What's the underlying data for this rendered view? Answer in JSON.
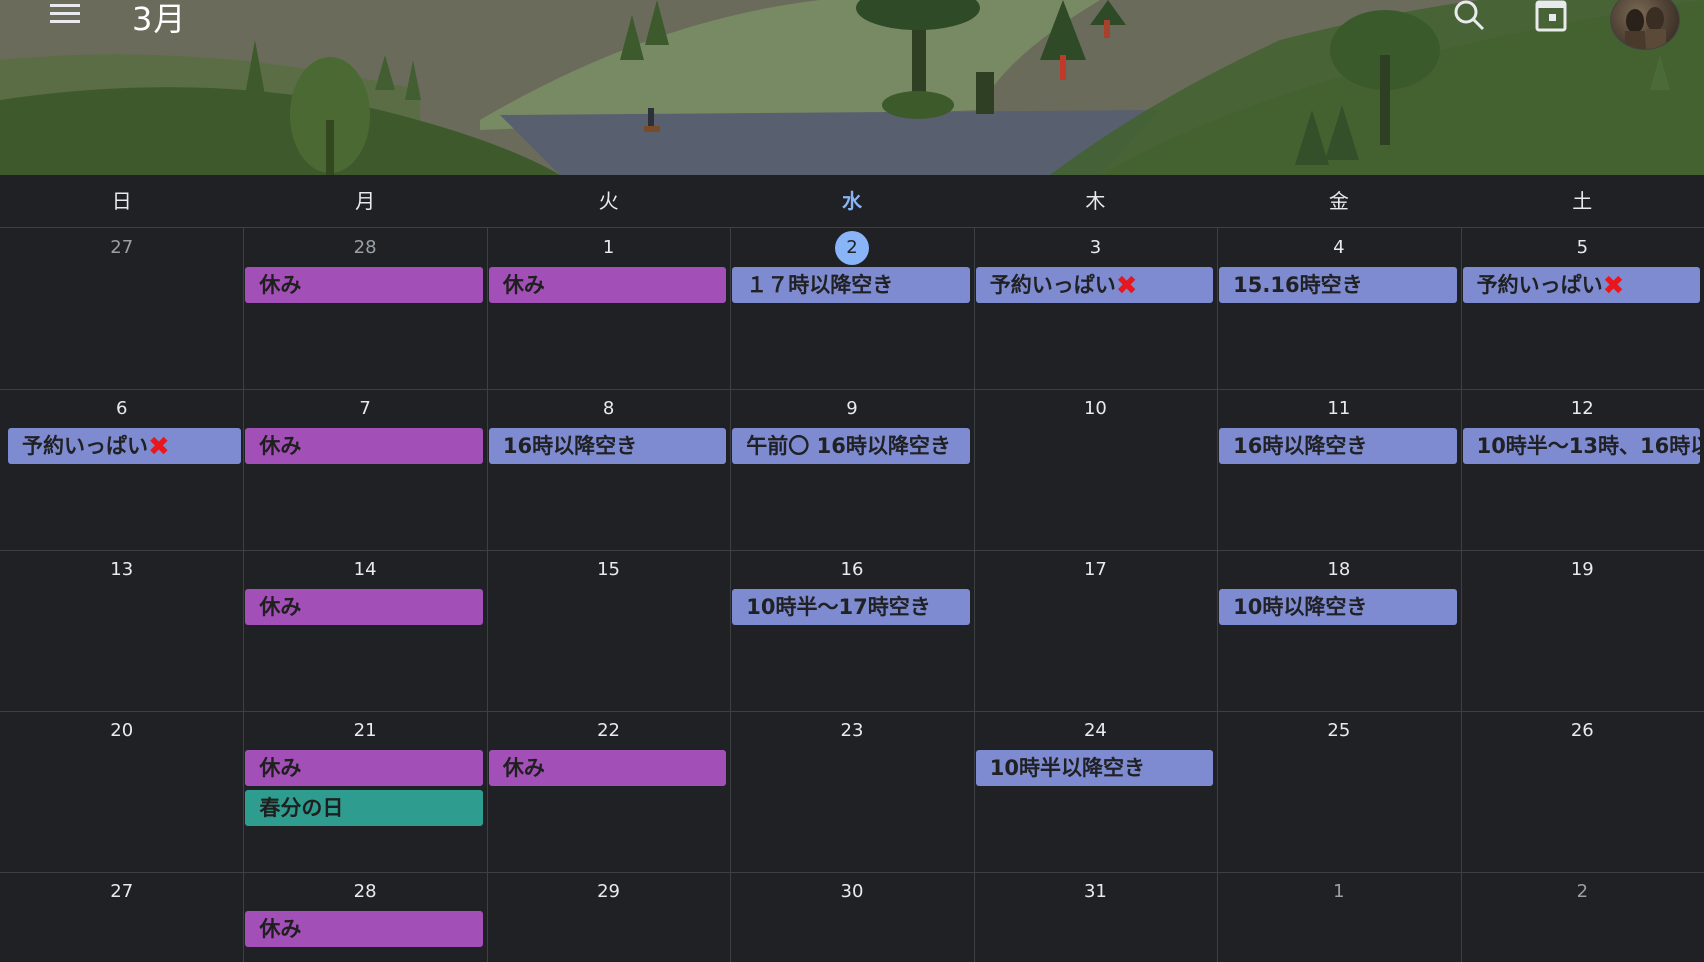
{
  "header": {
    "month_title": "3月",
    "icons": [
      "menu-icon",
      "search-icon",
      "calendar-today-icon",
      "avatar"
    ]
  },
  "weekdays": [
    {
      "label": "日",
      "today": false
    },
    {
      "label": "月",
      "today": false
    },
    {
      "label": "火",
      "today": false
    },
    {
      "label": "水",
      "today": true
    },
    {
      "label": "木",
      "today": false
    },
    {
      "label": "金",
      "today": false
    },
    {
      "label": "土",
      "today": false
    }
  ],
  "weeks": [
    [
      {
        "day": "27",
        "muted": true,
        "today": false,
        "events": []
      },
      {
        "day": "28",
        "muted": true,
        "today": false,
        "events": [
          {
            "label": "休み",
            "color": "purple",
            "mark": false
          }
        ]
      },
      {
        "day": "1",
        "muted": false,
        "today": false,
        "events": [
          {
            "label": "休み",
            "color": "purple",
            "mark": false
          }
        ]
      },
      {
        "day": "2",
        "muted": false,
        "today": true,
        "events": [
          {
            "label": "１７時以降空き",
            "color": "blue",
            "mark": false
          }
        ]
      },
      {
        "day": "3",
        "muted": false,
        "today": false,
        "events": [
          {
            "label": "予約いっぱい",
            "color": "blue",
            "mark": true
          }
        ]
      },
      {
        "day": "4",
        "muted": false,
        "today": false,
        "events": [
          {
            "label": "15.16時空き",
            "color": "blue",
            "mark": false
          }
        ]
      },
      {
        "day": "5",
        "muted": false,
        "today": false,
        "events": [
          {
            "label": "予約いっぱい",
            "color": "blue",
            "mark": true
          }
        ]
      }
    ],
    [
      {
        "day": "6",
        "muted": false,
        "today": false,
        "events": [
          {
            "label": "予約いっぱい",
            "color": "blue",
            "mark": true
          }
        ]
      },
      {
        "day": "7",
        "muted": false,
        "today": false,
        "events": [
          {
            "label": "休み",
            "color": "purple",
            "mark": false
          }
        ]
      },
      {
        "day": "8",
        "muted": false,
        "today": false,
        "events": [
          {
            "label": "16時以降空き",
            "color": "blue",
            "mark": false
          }
        ]
      },
      {
        "day": "9",
        "muted": false,
        "today": false,
        "events": [
          {
            "label": "午前〇 16時以降空き",
            "color": "blue",
            "mark": false
          }
        ]
      },
      {
        "day": "10",
        "muted": false,
        "today": false,
        "events": []
      },
      {
        "day": "11",
        "muted": false,
        "today": false,
        "events": [
          {
            "label": "16時以降空き",
            "color": "blue",
            "mark": false
          }
        ]
      },
      {
        "day": "12",
        "muted": false,
        "today": false,
        "events": [
          {
            "label": "10時半〜13時、16時以",
            "color": "blue",
            "mark": false
          }
        ]
      }
    ],
    [
      {
        "day": "13",
        "muted": false,
        "today": false,
        "events": []
      },
      {
        "day": "14",
        "muted": false,
        "today": false,
        "events": [
          {
            "label": "休み",
            "color": "purple",
            "mark": false
          }
        ]
      },
      {
        "day": "15",
        "muted": false,
        "today": false,
        "events": []
      },
      {
        "day": "16",
        "muted": false,
        "today": false,
        "events": [
          {
            "label": "10時半〜17時空き",
            "color": "blue",
            "mark": false
          }
        ]
      },
      {
        "day": "17",
        "muted": false,
        "today": false,
        "events": []
      },
      {
        "day": "18",
        "muted": false,
        "today": false,
        "events": [
          {
            "label": "10時以降空き",
            "color": "blue",
            "mark": false
          }
        ]
      },
      {
        "day": "19",
        "muted": false,
        "today": false,
        "events": []
      }
    ],
    [
      {
        "day": "20",
        "muted": false,
        "today": false,
        "events": []
      },
      {
        "day": "21",
        "muted": false,
        "today": false,
        "events": [
          {
            "label": "休み",
            "color": "purple",
            "mark": false
          },
          {
            "label": "春分の日",
            "color": "teal",
            "mark": false
          }
        ]
      },
      {
        "day": "22",
        "muted": false,
        "today": false,
        "events": [
          {
            "label": "休み",
            "color": "purple",
            "mark": false
          }
        ]
      },
      {
        "day": "23",
        "muted": false,
        "today": false,
        "events": []
      },
      {
        "day": "24",
        "muted": false,
        "today": false,
        "events": [
          {
            "label": "10時半以降空き",
            "color": "blue",
            "mark": false
          }
        ]
      },
      {
        "day": "25",
        "muted": false,
        "today": false,
        "events": []
      },
      {
        "day": "26",
        "muted": false,
        "today": false,
        "events": []
      }
    ],
    [
      {
        "day": "27",
        "muted": false,
        "today": false,
        "events": []
      },
      {
        "day": "28",
        "muted": false,
        "today": false,
        "events": [
          {
            "label": "休み",
            "color": "purple",
            "mark": false
          }
        ]
      },
      {
        "day": "29",
        "muted": false,
        "today": false,
        "events": []
      },
      {
        "day": "30",
        "muted": false,
        "today": false,
        "events": []
      },
      {
        "day": "31",
        "muted": false,
        "today": false,
        "events": []
      },
      {
        "day": "1",
        "muted": true,
        "today": false,
        "events": []
      },
      {
        "day": "2",
        "muted": true,
        "today": false,
        "events": []
      }
    ]
  ],
  "x_mark": "❌",
  "colors": {
    "purple": "#a250b8",
    "blue": "#7f8bd0",
    "teal": "#2e9d8f",
    "today_accent": "#8ab4f8",
    "background": "#202124"
  }
}
